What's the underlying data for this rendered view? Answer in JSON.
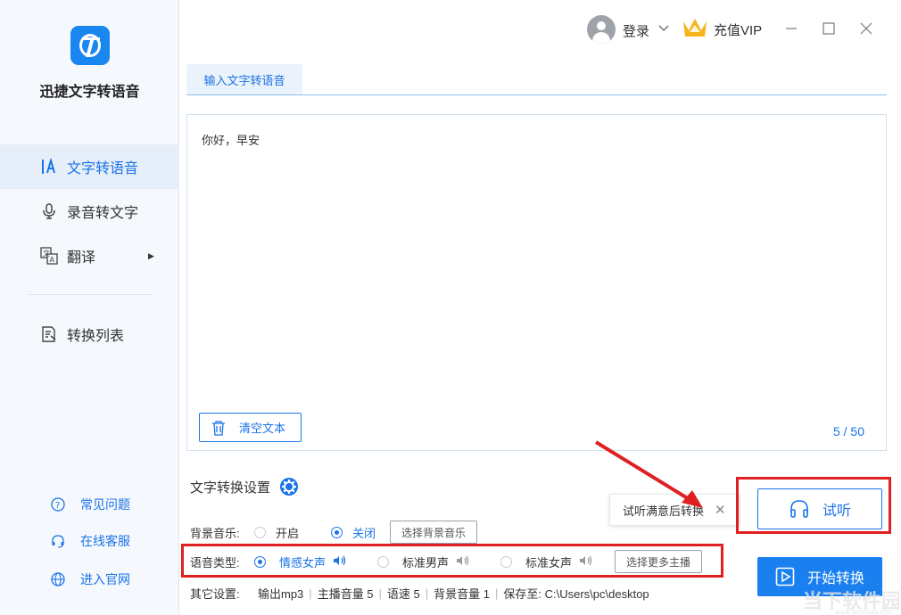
{
  "app": {
    "name": "迅捷文字转语音"
  },
  "sidebar": {
    "items": [
      {
        "label": "文字转语音",
        "icon": "text-audio-icon",
        "active": true
      },
      {
        "label": "录音转文字",
        "icon": "microphone-icon"
      },
      {
        "label": "翻译",
        "icon": "translate-icon",
        "has_submenu": true
      },
      {
        "label": "转换列表",
        "icon": "list-icon"
      }
    ],
    "help": [
      {
        "label": "常见问题",
        "icon": "question-icon"
      },
      {
        "label": "在线客服",
        "icon": "headset-icon"
      },
      {
        "label": "进入官网",
        "icon": "globe-icon"
      }
    ]
  },
  "topbar": {
    "login_label": "登录",
    "vip_label": "充值VIP"
  },
  "tab": {
    "label": "输入文字转语音"
  },
  "editor": {
    "text": "你好，早安",
    "clear_label": "清空文本",
    "counter": "5 / 50"
  },
  "settings": {
    "title": "文字转换设置",
    "bgm": {
      "label": "背景音乐:",
      "on_label": "开启",
      "off_label": "关闭",
      "selected": "off",
      "choose_label": "选择背景音乐"
    },
    "voice": {
      "label": "语音类型:",
      "options": [
        "情感女声",
        "标准男声",
        "标准女声"
      ],
      "selected_index": 0,
      "more_label": "选择更多主播"
    },
    "other": {
      "label": "其它设置:",
      "items": [
        "输出mp3",
        "主播音量 5",
        "语速 5",
        "背景音量 1",
        "保存至: C:\\Users\\pc\\desktop"
      ]
    }
  },
  "tooltip": {
    "text": "试听满意后转换"
  },
  "actions": {
    "listen_label": "试听",
    "start_label": "开始转换"
  },
  "colors": {
    "accent": "#1a73e8",
    "annotation": "#e02020"
  }
}
